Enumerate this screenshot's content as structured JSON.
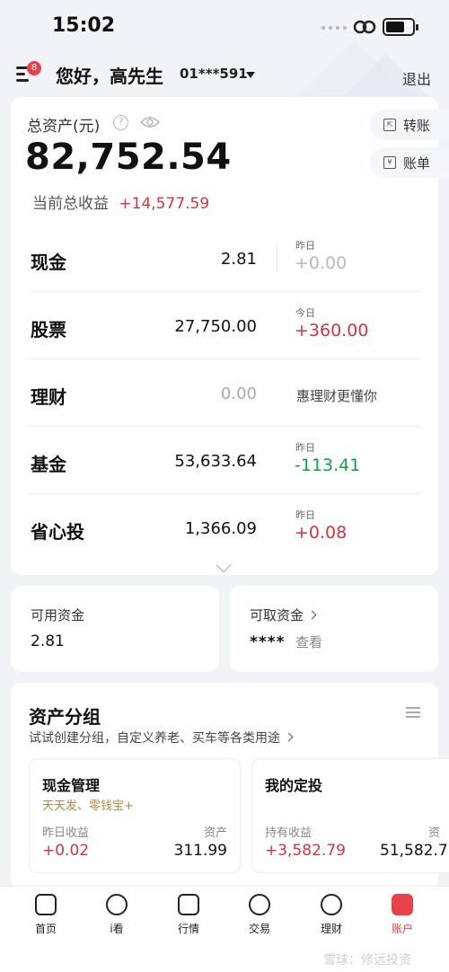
{
  "status_bar": {
    "time": "15:02"
  },
  "header": {
    "menu_badge": "8",
    "greeting": "您好，高先生",
    "account_masked": "01***591",
    "logout_label": "退出"
  },
  "summary": {
    "total_label": "总资产(元)",
    "total_value": "82,752.54",
    "profit_label": "当前总收益",
    "profit_value": "+14,577.59",
    "transfer_label": "转账",
    "ledger_label": "账单"
  },
  "assets": [
    {
      "name": "现金",
      "amount": "2.81",
      "tag": "昨日",
      "change": "+0.00",
      "trend": "gray"
    },
    {
      "name": "股票",
      "amount": "27,750.00",
      "tag": "今日",
      "change": "+360.00",
      "trend": "up"
    },
    {
      "name": "理财",
      "amount": "0.00",
      "tag": "",
      "change": "",
      "note": "惠理财更懂你",
      "trend": "none"
    },
    {
      "name": "基金",
      "amount": "53,633.64",
      "tag": "昨日",
      "change": "-113.41",
      "trend": "down"
    },
    {
      "name": "省心投",
      "amount": "1,366.09",
      "tag": "昨日",
      "change": "+0.08",
      "trend": "up"
    }
  ],
  "funds": {
    "available_label": "可用资金",
    "available_value": "2.81",
    "withdrawable_label": "可取资金",
    "withdrawable_value": "****",
    "withdrawable_view": "查看"
  },
  "groups": {
    "title": "资产分组",
    "subtitle": "试试创建分组，自定义养老、买车等各类用途",
    "cards": [
      {
        "title": "现金管理",
        "desc": "天天发、零钱宝+",
        "left_label": "昨日收益",
        "right_label": "资产",
        "left_value": "+0.02",
        "right_value": "311.99"
      },
      {
        "title": "我的定投",
        "desc": "",
        "left_label": "持有收益",
        "right_label": "资",
        "left_value": "+3,582.79",
        "right_value": "51,582.7"
      }
    ]
  },
  "tabs": [
    {
      "label": "首页",
      "icon": "home-icon"
    },
    {
      "label": "i看",
      "icon": "play-icon"
    },
    {
      "label": "行情",
      "icon": "chart-icon"
    },
    {
      "label": "交易",
      "icon": "exchange-icon"
    },
    {
      "label": "理财",
      "icon": "wealth-icon"
    },
    {
      "label": "账户",
      "icon": "account-icon"
    }
  ],
  "watermark": "雪球：修远投资",
  "colors": {
    "accent_red": "#e8414a",
    "up_red": "#d7333d",
    "down_green": "#1a9a4c",
    "gold": "#b28a3f"
  }
}
